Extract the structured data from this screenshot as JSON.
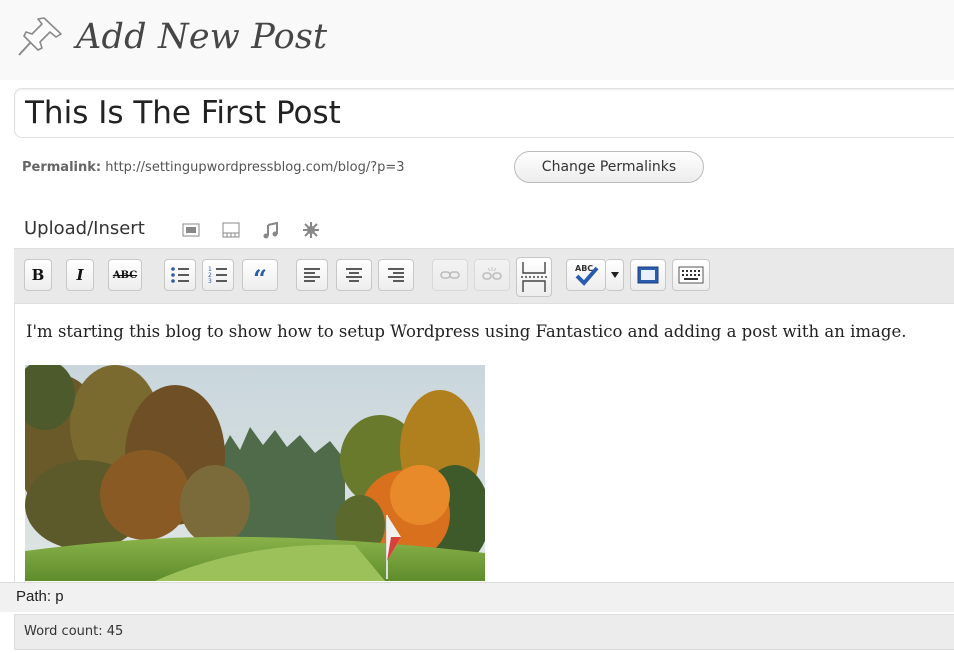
{
  "header": {
    "title": "Add New Post",
    "icon": "pushpin-icon"
  },
  "post": {
    "title_value": "This Is The First Post"
  },
  "permalink": {
    "label": "Permalink:",
    "url": "http://settingupwordpressblog.com/blog/?p=3",
    "button_label": "Change Permalinks"
  },
  "upload": {
    "label": "Upload/Insert",
    "icons": [
      "add-image-icon",
      "add-video-icon",
      "add-audio-icon",
      "add-media-icon"
    ]
  },
  "toolbar": {
    "buttons": [
      {
        "name": "bold-button",
        "label": "B"
      },
      {
        "name": "italic-button",
        "label": "I"
      },
      {
        "name": "strikethrough-button",
        "label": "ABC"
      },
      {
        "name": "unordered-list-button",
        "label": ""
      },
      {
        "name": "ordered-list-button",
        "label": ""
      },
      {
        "name": "blockquote-button",
        "label": "“"
      },
      {
        "name": "align-left-button",
        "label": ""
      },
      {
        "name": "align-center-button",
        "label": ""
      },
      {
        "name": "align-right-button",
        "label": ""
      },
      {
        "name": "insert-link-button",
        "label": ""
      },
      {
        "name": "unlink-button",
        "label": ""
      },
      {
        "name": "insert-more-button",
        "label": ""
      },
      {
        "name": "spellcheck-button",
        "label": "ABC"
      },
      {
        "name": "spellcheck-dropdown",
        "label": ""
      },
      {
        "name": "fullscreen-button",
        "label": ""
      },
      {
        "name": "kitchen-sink-button",
        "label": ""
      }
    ]
  },
  "editor": {
    "text": "I'm starting this blog to show how to setup Wordpress using Fantastico and adding a post with an image.",
    "image": "golf-course-image"
  },
  "status": {
    "path": "Path: p",
    "word_count": "Word count: 45"
  },
  "colors": {
    "toolbar_bg": "#e9e9e9",
    "title_color": "#464646",
    "blockquote_blue": "#2a5db0"
  }
}
